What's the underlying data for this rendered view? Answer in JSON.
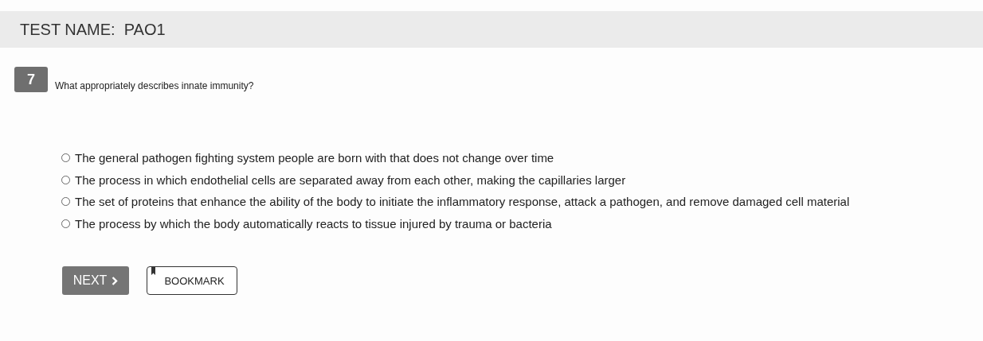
{
  "header": {
    "title": "TEST NAME:  PAO1"
  },
  "question": {
    "number": "7",
    "text": "What appropriately describes innate immunity?"
  },
  "options": [
    {
      "label": "The general pathogen fighting system people are born with that does not change over time",
      "selected": false
    },
    {
      "label": "The process in which endothelial cells are separated away from each other, making the capillaries larger",
      "selected": false
    },
    {
      "label": "The set of proteins that enhance the ability of the body to initiate the inflammatory response, attack a pathogen, and remove damaged cell material",
      "selected": false
    },
    {
      "label": "The process by which the body automatically reacts to tissue injured by trauma or bacteria",
      "selected": false
    }
  ],
  "buttons": {
    "next": "NEXT",
    "bookmark": "BOOKMARK"
  }
}
